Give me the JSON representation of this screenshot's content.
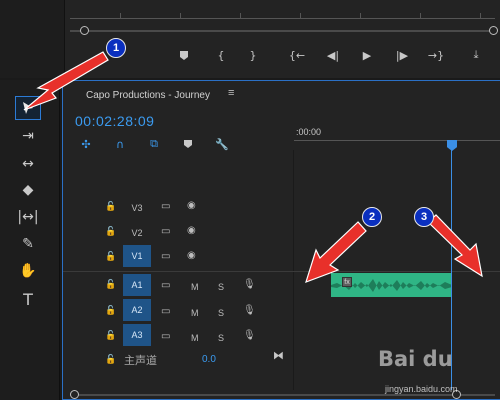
{
  "timeline": {
    "title": "Capo Productions - Journey",
    "menu_glyph": "≡",
    "timecode": "00:02:28:09",
    "ruler_time": ":00:00"
  },
  "tracks": {
    "video": [
      {
        "name": "V3",
        "targeted": false
      },
      {
        "name": "V2",
        "targeted": false
      },
      {
        "name": "V1",
        "targeted": true
      }
    ],
    "audio": [
      {
        "name": "A1",
        "mute": "M",
        "solo": "S"
      },
      {
        "name": "A2",
        "mute": "M",
        "solo": "S"
      },
      {
        "name": "A3",
        "mute": "M",
        "solo": "S"
      }
    ],
    "master": {
      "label": "主声道",
      "value": "0.0"
    }
  },
  "annotations": [
    "1",
    "2",
    "3"
  ],
  "watermark": {
    "logo": "Bai du",
    "url": "jingyan.baidu.com"
  },
  "colors": {
    "accent": "#3b9bf0",
    "clip": "#2fb585",
    "arrow": "#e8302a",
    "badge": "#0a2fbf"
  },
  "icons": {
    "tools": [
      "selection-tool-icon",
      "track-select-icon",
      "ripple-edit-icon",
      "razor-icon",
      "slip-icon",
      "pen-icon",
      "hand-icon",
      "type-icon"
    ],
    "transport": [
      "marker-icon",
      "in-point-icon",
      "out-point-icon",
      "go-to-in-icon",
      "step-back-icon",
      "play-icon",
      "step-forward-icon",
      "go-to-out-icon"
    ]
  }
}
